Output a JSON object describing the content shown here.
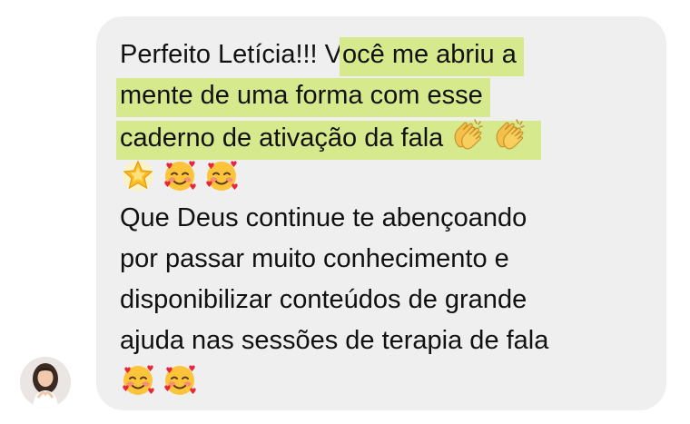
{
  "message": {
    "line1_a": "Perfeito Letícia!!! V",
    "line1_b": "ocê me abriu a",
    "line2": "mente de uma forma com esse",
    "line3": "caderno de ativação da fala",
    "line5": "Que Deus continue te abençoando",
    "line6": "por passar muito conhecimento e",
    "line7": "disponibilizar conteúdos de grande",
    "line8": "ajuda nas sessões de terapia de fala"
  },
  "emojis": {
    "line3": [
      "clapping-hands",
      "clapping-hands"
    ],
    "line4": [
      "glowing-star",
      "smiling-face-with-hearts",
      "smiling-face-with-hearts"
    ],
    "line9": [
      "smiling-face-with-hearts",
      "smiling-face-with-hearts"
    ]
  },
  "colors": {
    "bubble": "#efefef",
    "highlight": "#d6ea8d",
    "text": "#111111"
  }
}
